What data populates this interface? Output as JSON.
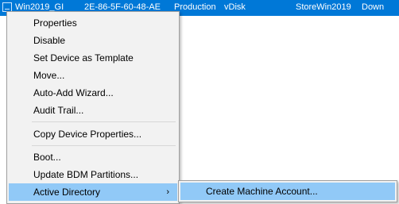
{
  "row": {
    "icon": "device-icon",
    "name": "Win2019_GI",
    "mac": "2E-86-5F-60-48-AE",
    "collection": "Production",
    "boot_from": "vDisk",
    "vdisk": "StoreWin2019",
    "status": "Down"
  },
  "menu": {
    "items": [
      {
        "label": "Properties"
      },
      {
        "label": "Disable"
      },
      {
        "label": "Set Device as Template"
      },
      {
        "label": "Move..."
      },
      {
        "label": "Auto-Add Wizard..."
      },
      {
        "label": "Audit Trail..."
      },
      {
        "label": "Copy Device Properties..."
      },
      {
        "label": "Boot..."
      },
      {
        "label": "Update BDM Partitions..."
      },
      {
        "label": "Active Directory",
        "submenu_arrow": "›"
      }
    ]
  },
  "submenu": {
    "items": [
      {
        "label": "Create Machine Account..."
      }
    ]
  },
  "colors": {
    "row_selected": "#0078d7",
    "menu_highlight": "#91c9f7",
    "menu_background": "#f2f2f2"
  }
}
